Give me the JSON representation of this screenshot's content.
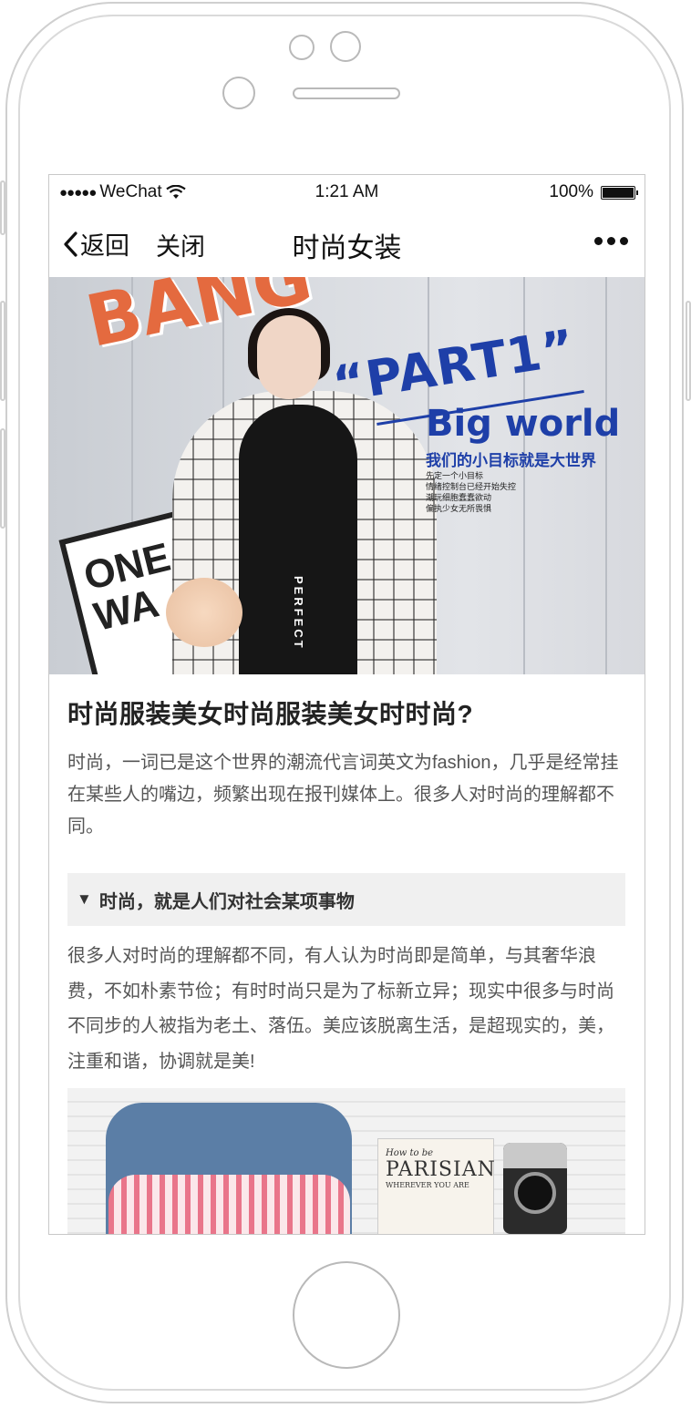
{
  "status_bar": {
    "signal": "●●●●●",
    "carrier": "WeChat",
    "time": "1:21 AM",
    "battery": "100%"
  },
  "nav": {
    "back_label": "返回",
    "close_label": "关闭",
    "title": "时尚女装"
  },
  "hero": {
    "part1": "“PART1”",
    "big_world": "Big world",
    "sub": "我们的小目标就是大世界",
    "lines": [
      "先定一个小目标",
      "情绪控制台已经开始失控",
      "潮玩细胞蠢蠢欲动",
      "偏执少女无所畏惧"
    ],
    "sign_text": [
      "ONE",
      "WA"
    ],
    "logo_text": "BANG",
    "pants_text": "PERFECT"
  },
  "article": {
    "title": "时尚服装美女时尚服装美女时时尚?",
    "intro": "时尚，一词已是这个世界的潮流代言词英文为fashion，几乎是经常挂在某些人的嘴边，频繁出现在报刊媒体上。很多人对时尚的理解都不同。",
    "section_heading": "时尚，就是人们对社会某项事物",
    "section_marker": "▼",
    "body": "很多人对时尚的理解都不同，有人认为时尚即是简单，与其奢华浪费，不如朴素节俭；有时时尚只是为了标新立异；现实中很多与时尚不同步的人被指为老土、落伍。美应该脱离生活，是超现实的，美，注重和谐，协调就是美!"
  },
  "photo2": {
    "book_line1": "How to be",
    "book_line2": "PARISIAN",
    "book_line3": "WHEREVER YOU ARE"
  }
}
